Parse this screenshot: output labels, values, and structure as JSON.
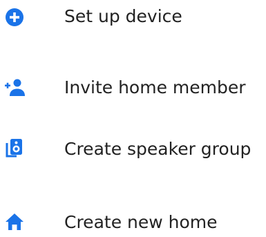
{
  "colors": {
    "accent": "#1a73e8",
    "text": "#222222"
  },
  "menu": {
    "items": [
      {
        "icon": "add-circle-icon",
        "label": "Set up device"
      },
      {
        "icon": "person-add-icon",
        "label": "Invite home member"
      },
      {
        "icon": "speaker-icon",
        "label": "Create speaker group"
      },
      {
        "icon": "home-icon",
        "label": "Create new home"
      }
    ]
  }
}
